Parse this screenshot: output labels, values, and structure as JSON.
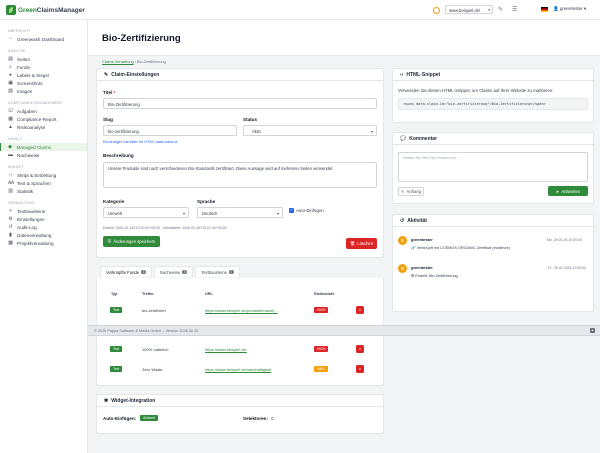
{
  "app": {
    "logo_green": "Green",
    "logo_rest": "ClaimsManager"
  },
  "topbar": {
    "domain": "www.beispiel.de/",
    "user": "greentester"
  },
  "sidebar": {
    "sections": [
      "Übersicht",
      "Analyse",
      "Compliance-Management",
      "Inhalt",
      "Widget",
      "Verwaltung"
    ],
    "items": [
      {
        "label": "Greenwash Dashboard"
      },
      {
        "label": "Seiten"
      },
      {
        "label": "Funde"
      },
      {
        "label": "Labels & Siegel"
      },
      {
        "label": "Screenshots"
      },
      {
        "label": "Images"
      },
      {
        "label": "Aufgaben"
      },
      {
        "label": "Compliance-Report"
      },
      {
        "label": "Risikoanalyse"
      },
      {
        "label": "Managed Claims"
      },
      {
        "label": "Nachweise"
      },
      {
        "label": "Skript & Einbettung"
      },
      {
        "label": "Text & Sprachen"
      },
      {
        "label": "Statistik"
      },
      {
        "label": "Textbausteine"
      },
      {
        "label": "Einstellungen"
      },
      {
        "label": "Audit-Log"
      },
      {
        "label": "Datenverwaltung"
      },
      {
        "label": "Projektverwaltung"
      }
    ]
  },
  "page": {
    "title": "Bio-Zertifizierung",
    "breadcrumb_link": "Claims-Verwaltung",
    "breadcrumb_sep": "›",
    "breadcrumb_current": "Bio-Zertifizierung"
  },
  "settings": {
    "header": "Claim-Einstellungen",
    "title_label": "Titel",
    "title_value": "Bio-Zertifizierung",
    "slug_label": "Slug",
    "slug_value": "bio-zertifizierung",
    "slug_hint": "Eindeutiger Identifier für HTML data-claim-id.",
    "status_label": "Status",
    "status_value": "Aktiv",
    "desc_label": "Beschreibung",
    "desc_value": "Unsere Produkte sind nach verschiedenen Bio-Standards zertifiziert. Diese Aussage wird auf mehreren Seiten verwendet.",
    "category_label": "Kategorie",
    "category_value": "Umwelt",
    "language_label": "Sprache",
    "language_value": "Deutsch",
    "auto_insert_label": "Auto-Einfügen",
    "meta": "Erstellt: 2026-01-16T10:00:00+00:00 · Aktualisiert: 2026-02-16T10:21:40+00:00",
    "save_label": "Änderungen speichern",
    "delete_label": "Löschen"
  },
  "tabs": [
    {
      "label": "Verknüpfte Funde",
      "count": "3"
    },
    {
      "label": "Nachweise",
      "count": "0"
    },
    {
      "label": "Textbausteine",
      "count": "0"
    }
  ],
  "findings": {
    "columns": [
      "Typ",
      "Treffer",
      "URL",
      "Risikostufe"
    ],
    "rows": [
      {
        "type": "Text",
        "hit": "bio-zertifiziert",
        "url": "https://www.beispiel.de/produkte/nachh...",
        "risk": "HIGH",
        "risk_color": "#dc2626"
      },
      {
        "type": "Text",
        "hit": "100% natürlich",
        "url": "https://www.beispiel.de/",
        "risk": "HIGH",
        "risk_color": "#dc2626"
      },
      {
        "type": "Text",
        "hit": "Zero Waste",
        "url": "https://www.beispiel.de/nachhaltigkeit",
        "risk": "MED",
        "risk_color": "#f59e0b"
      }
    ]
  },
  "footer": {
    "text": "© 2026 Pappa Software & Media GmbH – Version 2026.02.26"
  },
  "widget": {
    "header": "Widget-Integration",
    "auto_label": "Auto-Einfügen:",
    "auto_badge": "Aktiviert",
    "selectors_label": "Selektoren:",
    "selectors_value": "0"
  },
  "snippet": {
    "header": "HTML-Snippet",
    "desc": "Verwenden Sie diesen HTML-Snippet, um Claims auf Ihrer Website zu markieren:",
    "code": "<span data-claim-id=\"bio-zertifizierung\">Bio-Zertifizierung</span>"
  },
  "comment": {
    "header": "Kommentar",
    "placeholder": "Geben Sie hier Ihre Notizen ein...",
    "attach_label": "Anhang",
    "reply_label": "Antworten"
  },
  "activity": {
    "header": "Aktivität",
    "items": [
      {
        "initial": "G",
        "user": "greentester",
        "time": "Mo, 29.01.26 10:30:00",
        "text": "Verknüpft mit COSMOS ORGANIC Zertifikat (evidence)"
      },
      {
        "initial": "G",
        "user": "greentester",
        "time": "Fr., 26.01.2026 12:00:00",
        "text": "Erstellt: Bio-Zertifizierung"
      }
    ]
  },
  "colors": {
    "accent": "#2f8a3a",
    "danger": "#dc2626",
    "warning": "#f59e0b"
  }
}
